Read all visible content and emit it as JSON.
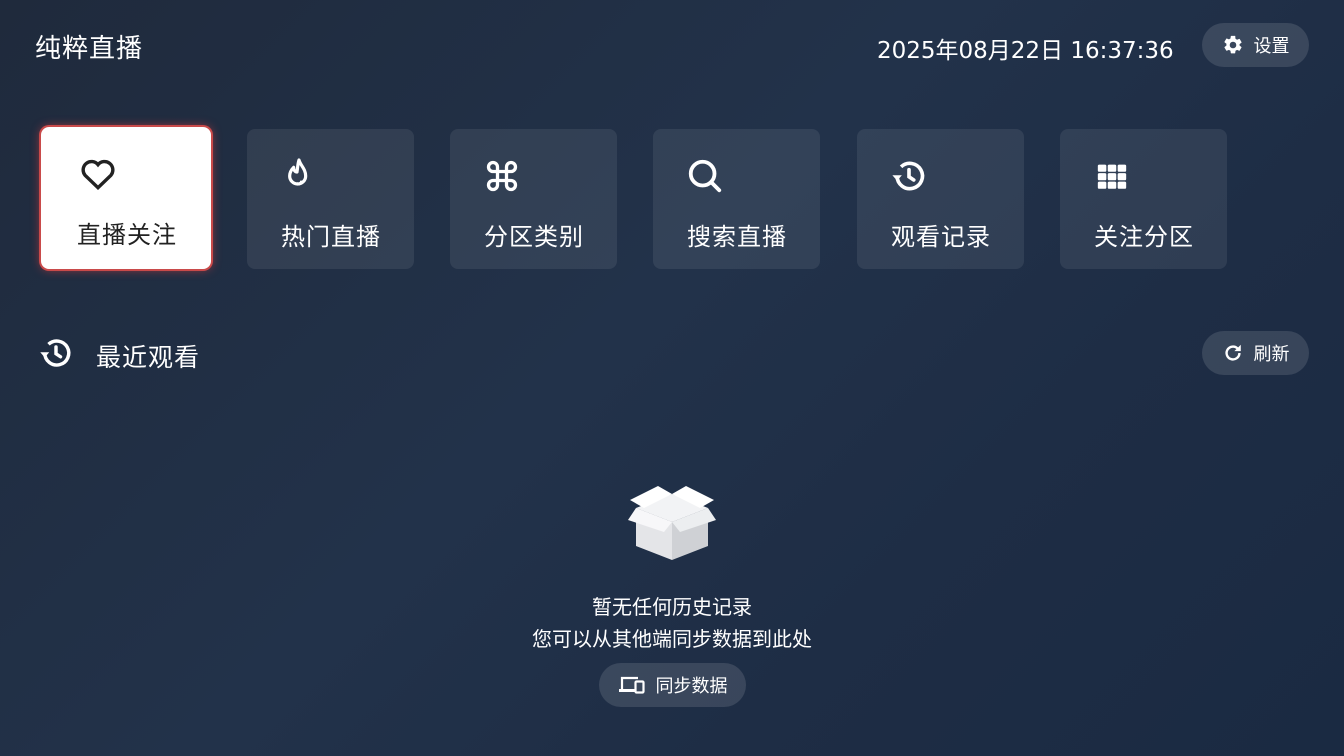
{
  "header": {
    "app_title": "纯粹直播",
    "datetime": "2025年08月22日 16:37:36",
    "settings_label": "设置"
  },
  "tiles": [
    {
      "label": "直播关注",
      "icon": "heart-icon",
      "selected": true
    },
    {
      "label": "热门直播",
      "icon": "flame-icon",
      "selected": false
    },
    {
      "label": "分区类别",
      "icon": "command-icon",
      "selected": false
    },
    {
      "label": "搜索直播",
      "icon": "search-icon",
      "selected": false
    },
    {
      "label": "观看记录",
      "icon": "history-icon",
      "selected": false
    },
    {
      "label": "关注分区",
      "icon": "grid-icon",
      "selected": false
    }
  ],
  "recent": {
    "title": "最近观看",
    "refresh_label": "刷新",
    "empty_line1": "暂无任何历史记录",
    "empty_line2": "您可以从其他端同步数据到此处",
    "sync_label": "同步数据"
  },
  "colors": {
    "background": "#1f2d44",
    "selected_tile_glow": "#c94a4a"
  }
}
